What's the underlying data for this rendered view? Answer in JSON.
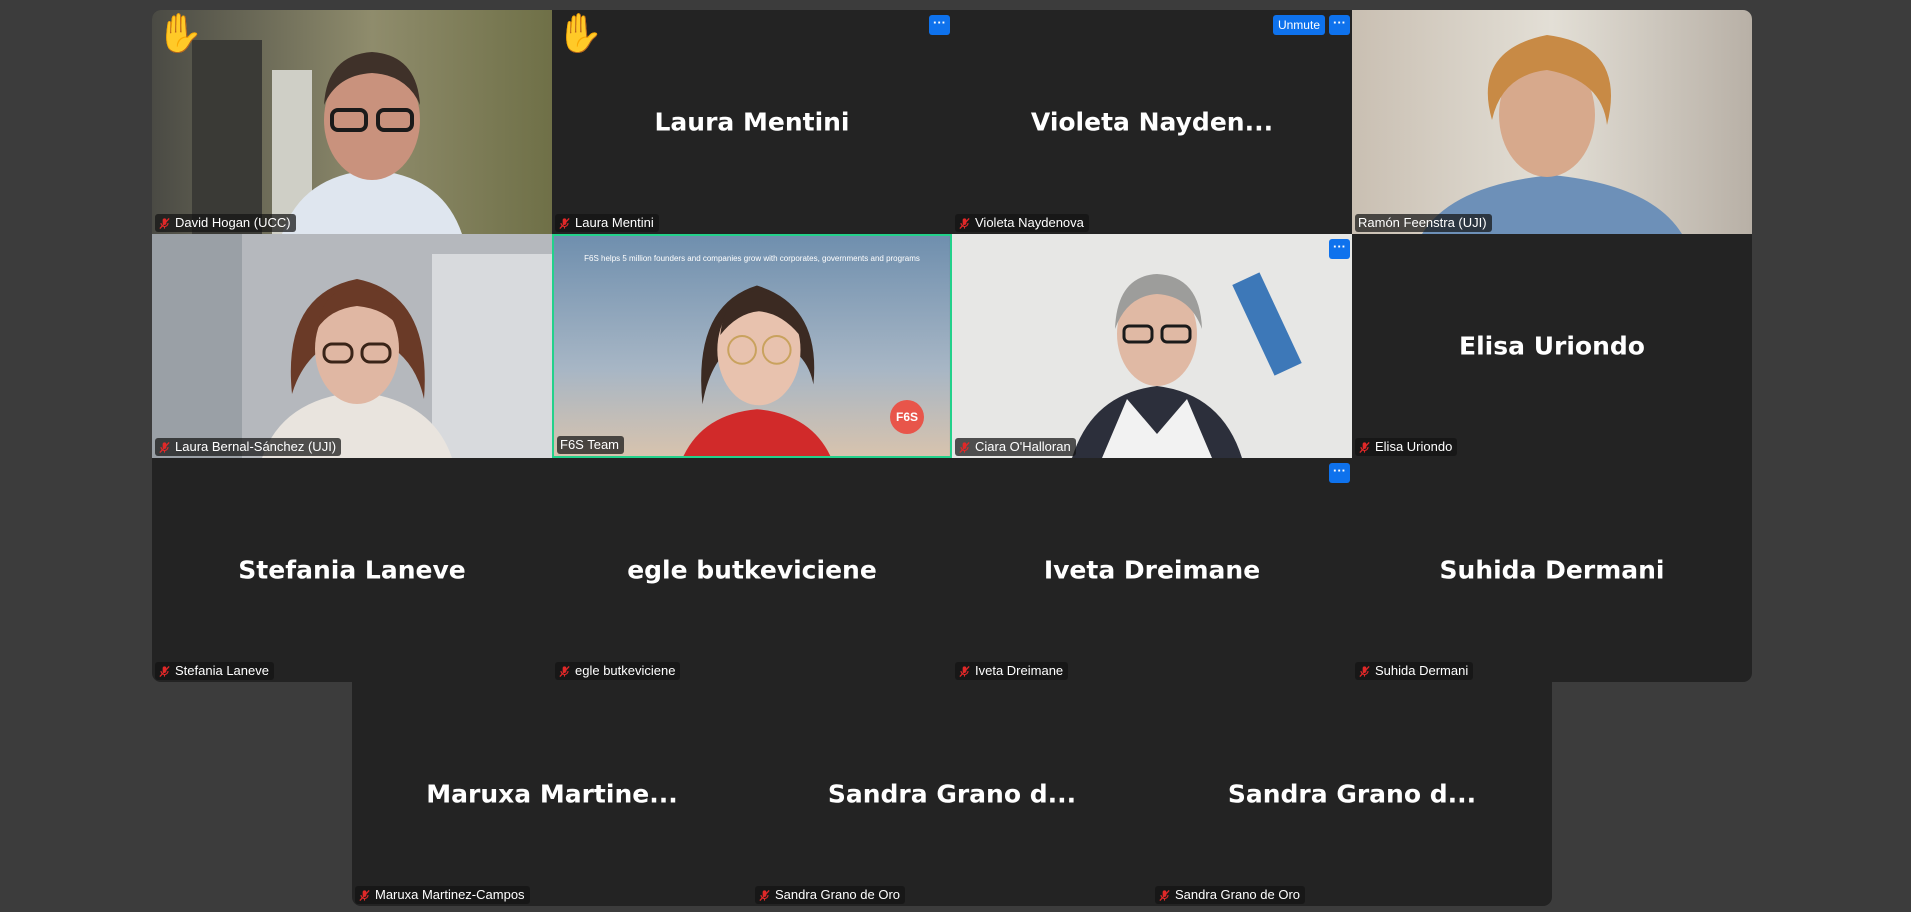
{
  "participants": [
    {
      "display": "",
      "label": "David Hogan (UCC)",
      "hand": "✋",
      "unmute": "",
      "more": ""
    },
    {
      "display": "Laura Mentini",
      "label": "Laura Mentini",
      "hand": "✋",
      "unmute": "",
      "more": "···"
    },
    {
      "display": "Violeta  Nayden...",
      "label": "Violeta Naydenova",
      "hand": "",
      "unmute": "Unmute",
      "more": "···"
    },
    {
      "display": "",
      "label": "Ramón Feenstra (UJI)",
      "hand": "",
      "unmute": "",
      "more": ""
    },
    {
      "display": "",
      "label": "Laura Bernal-Sánchez (UJI)",
      "hand": "",
      "unmute": "",
      "more": ""
    },
    {
      "display": "",
      "label": "F6S Team",
      "hand": "",
      "unmute": "",
      "more": ""
    },
    {
      "display": "",
      "label": "Ciara O'Halloran",
      "hand": "",
      "unmute": "",
      "more": "···"
    },
    {
      "display": "Elisa Uriondo",
      "label": "Elisa Uriondo",
      "hand": "",
      "unmute": "",
      "more": ""
    },
    {
      "display": "Stefania Laneve",
      "label": "Stefania Laneve",
      "hand": "",
      "unmute": "",
      "more": ""
    },
    {
      "display": "egle butkeviciene",
      "label": "egle butkeviciene",
      "hand": "",
      "unmute": "",
      "more": ""
    },
    {
      "display": "Iveta Dreimane",
      "label": "Iveta Dreimane",
      "hand": "",
      "unmute": "",
      "more": "···"
    },
    {
      "display": "Suhida Dermani",
      "label": "Suhida Dermani",
      "hand": "",
      "unmute": "",
      "more": ""
    },
    {
      "display": "Maruxa  Martine...",
      "label": "Maruxa Martinez-Campos",
      "hand": "",
      "unmute": "",
      "more": ""
    },
    {
      "display": "Sandra Grano d...",
      "label": "Sandra Grano de Oro",
      "hand": "",
      "unmute": "",
      "more": ""
    },
    {
      "display": "Sandra Grano d...",
      "label": "Sandra Grano de Oro",
      "hand": "",
      "unmute": "",
      "more": ""
    }
  ],
  "shared": {
    "slide_text": "F6S helps 5 million founders and companies grow with corporates, governments and programs",
    "logo_text": "F6S"
  },
  "colors": {
    "background": "#3c3c3c",
    "tile": "#232323",
    "active_speaker_border": "#23d18b",
    "button_blue": "#0e72ed",
    "muted_red": "#e02828"
  },
  "icons": {
    "mic": "muted-mic-icon",
    "hand": "raised-hand-icon",
    "more": "more-options-icon"
  }
}
